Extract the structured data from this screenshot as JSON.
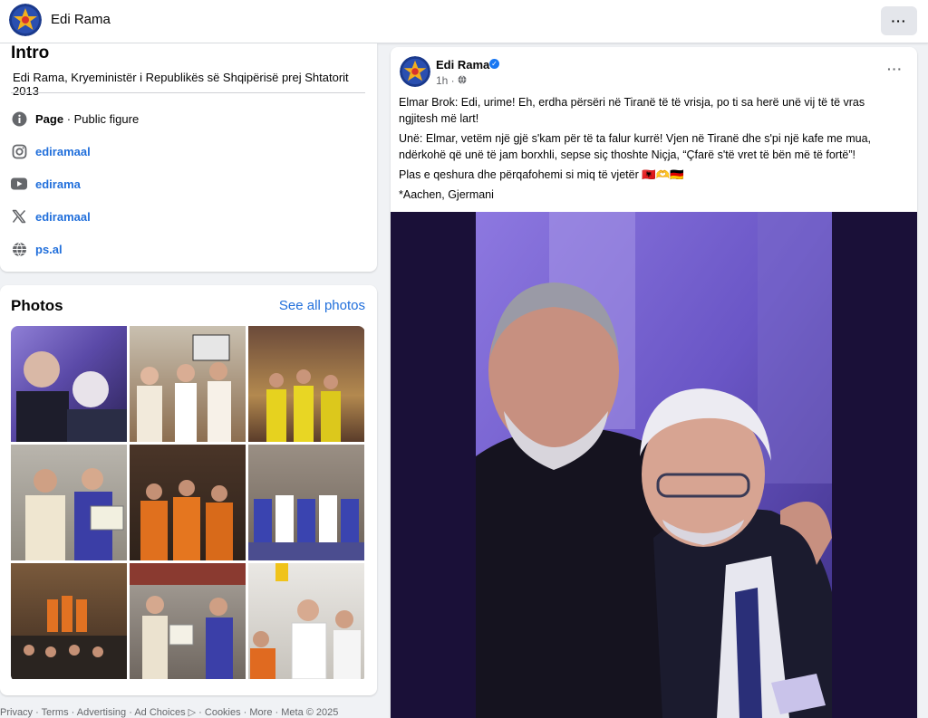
{
  "topbar": {
    "page_name": "Edi Rama",
    "more_label": "···"
  },
  "intro": {
    "title": "Intro",
    "bio": "Edi Rama, Kryeministër i Republikës së Shqipërisë prej Shtatorit 2013",
    "page_label": "Page",
    "category": " · Public figure",
    "instagram": "ediramaal",
    "youtube": "edirama",
    "x_handle": "ediramaal",
    "website": "ps.al"
  },
  "photos": {
    "title": "Photos",
    "see_all": "See all photos"
  },
  "footer": "Privacy · Terms · Advertising · Ad Choices ▷ · Cookies · More · Meta © 2025",
  "post": {
    "author": "Edi Rama",
    "time": "1h ·",
    "more": "···",
    "paragraphs": [
      "Elmar Brok: Edi, urime! Eh, erdha përsëri në Tiranë të të vrisja, po ti sa herë unë vij të të vras ngjitesh më lart!",
      "Unë: Elmar, vetëm një gjë s'kam për të ta falur kurrë! Vjen në Tiranë dhe s'pi një kafe me mua, ndërkohë që unë të jam borxhli, sepse siç thoshte Niçja, “Çfarë s'të vret të bën më të fortë”!",
      "Plas e qeshura dhe përqafohemi si miq të vjetër 🇦🇱🫶🇩🇪",
      "*Aachen, Gjermani"
    ]
  },
  "colors": {
    "link": "#216fdb",
    "verified": "#1877f2",
    "background": "#f0f2f5"
  },
  "icons": [
    "info-icon",
    "instagram-icon",
    "youtube-icon",
    "x-icon",
    "globe-icon",
    "verified-badge-icon",
    "globe-small-icon",
    "more-icon"
  ]
}
